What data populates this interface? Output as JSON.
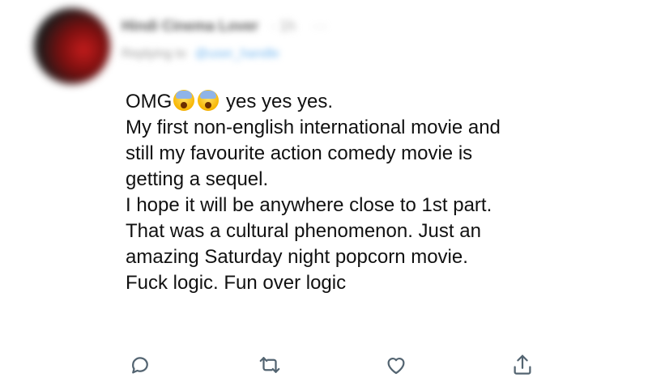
{
  "tweet": {
    "author": {
      "name": "Hindi Cinema Lover",
      "timestamp": "· 1h",
      "more": "···",
      "replying_label": "Replying to",
      "replying_to": "@user_handle"
    },
    "body": {
      "line1_a": "OMG",
      "line1_b": " yes yes yes.",
      "line2": "My first non-english international movie and",
      "line3": "still my favourite action comedy movie is",
      "line4": "getting a sequel.",
      "line5": "I hope it will be anywhere close to 1st part.",
      "line6": "That was a cultural phenomenon.  Just an",
      "line7": "amazing Saturday night popcorn movie.",
      "line8": "Fuck logic. Fun over logic"
    },
    "emojis": [
      "face-screaming-in-fear-icon",
      "face-screaming-in-fear-icon"
    ],
    "actions": [
      "reply-icon",
      "retweet-icon",
      "like-icon",
      "share-icon"
    ],
    "colors": {
      "text": "#111111",
      "icon": "#536471",
      "avatar_accent": "#c41c1c"
    }
  }
}
